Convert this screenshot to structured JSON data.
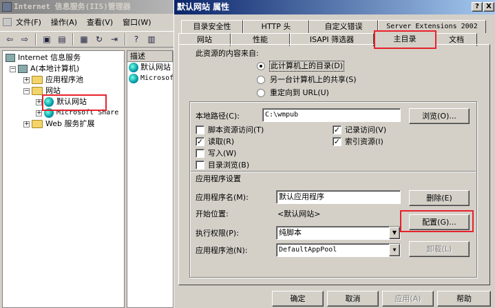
{
  "iis": {
    "title": "Internet 信息服务(IIS)管理器",
    "menu": [
      "文件(F)",
      "操作(A)",
      "查看(V)",
      "窗口(W)"
    ],
    "tree": {
      "root": "Internet 信息服务",
      "computer": "A(本地计算机)",
      "app_pools": "应用程序池",
      "websites": "网站",
      "default_site": "默认网站",
      "ms_share": "Microsoft Share",
      "web_ext": "Web 服务扩展"
    },
    "list": {
      "header": "描述",
      "rows": [
        "默认网站",
        "Microsof"
      ]
    }
  },
  "dialog": {
    "title": "默认网站 属性",
    "help_btn": "?",
    "close_btn": "X",
    "tabs_back": [
      "目录安全性",
      "HTTP 头",
      "自定义错误",
      "Server Extensions 2002"
    ],
    "tabs_front": [
      "网站",
      "性能",
      "ISAPI 筛选器",
      "主目录",
      "文档"
    ],
    "content_source_label": "此资源的内容来自:",
    "radio": [
      "此计算机上的目录(D)",
      "另一台计算机上的共享(S)",
      "重定向到 URL(U)"
    ],
    "local_path_label": "本地路径(C):",
    "local_path_value": "C:\\wmpub",
    "browse_btn": "浏览(O)...",
    "checks_left": [
      {
        "label": "脚本资源访问(T)",
        "checked": false
      },
      {
        "label": "读取(R)",
        "checked": true
      },
      {
        "label": "写入(W)",
        "checked": false
      },
      {
        "label": "目录浏览(B)",
        "checked": false
      }
    ],
    "checks_right": [
      {
        "label": "记录访问(V)",
        "checked": true
      },
      {
        "label": "索引资源(I)",
        "checked": true
      }
    ],
    "app_settings_label": "应用程序设置",
    "app_name_label": "应用程序名(M):",
    "app_name_value": "默认应用程序",
    "remove_btn": "删除(E)",
    "start_point_label": "开始位置:",
    "start_point_value": "<默认网站>",
    "config_btn": "配置(G)...",
    "exec_perm_label": "执行权限(P):",
    "exec_perm_value": "纯脚本",
    "unload_btn": "卸载(L)",
    "app_pool_label": "应用程序池(N):",
    "app_pool_value": "DefaultAppPool",
    "ok_btn": "确定",
    "cancel_btn": "取消",
    "apply_btn": "应用(A)",
    "help_bottom_btn": "帮助"
  },
  "colors": {
    "highlight": "#e8202a",
    "title_active": "#0a246a",
    "title_inactive": "#808080"
  }
}
